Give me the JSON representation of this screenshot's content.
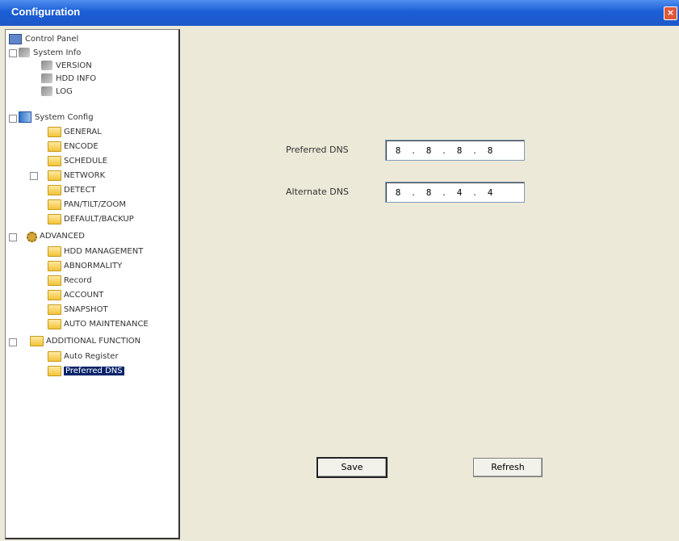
{
  "window": {
    "title": "Configuration",
    "close_label": "×"
  },
  "tree": {
    "items": [
      {
        "label": "Control Panel",
        "icon": "monitor-icon",
        "level": 0
      },
      {
        "label": "System Info",
        "icon": "tool-icon",
        "level": 0
      },
      {
        "label": "VERSION",
        "icon": "tool-icon",
        "level": 1
      },
      {
        "label": "HDD INFO",
        "icon": "tool-icon",
        "level": 1
      },
      {
        "label": "LOG",
        "icon": "tool-icon",
        "level": 1
      },
      {
        "label": "System Config",
        "icon": "sys-icon",
        "level": 0
      },
      {
        "label": "GENERAL",
        "icon": "folder-icon",
        "level": 1
      },
      {
        "label": "ENCODE",
        "icon": "folder-icon",
        "level": 1
      },
      {
        "label": "SCHEDULE",
        "icon": "folder-icon",
        "level": 1
      },
      {
        "label": "NETWORK",
        "icon": "folder-icon",
        "level": 1
      },
      {
        "label": "DETECT",
        "icon": "folder-icon",
        "level": 1
      },
      {
        "label": "PAN/TILT/ZOOM",
        "icon": "folder-icon",
        "level": 1
      },
      {
        "label": "DEFAULT/BACKUP",
        "icon": "folder-icon",
        "level": 1
      },
      {
        "label": "ADVANCED",
        "icon": "gear-icon",
        "level": 0
      },
      {
        "label": "HDD MANAGEMENT",
        "icon": "folder-icon",
        "level": 1
      },
      {
        "label": "ABNORMALITY",
        "icon": "folder-icon",
        "level": 1
      },
      {
        "label": "Record",
        "icon": "folder-icon",
        "level": 1
      },
      {
        "label": "ACCOUNT",
        "icon": "folder-icon",
        "level": 1
      },
      {
        "label": "SNAPSHOT",
        "icon": "folder-icon",
        "level": 1
      },
      {
        "label": "AUTO MAINTENANCE",
        "icon": "folder-icon",
        "level": 1
      },
      {
        "label": "ADDITIONAL FUNCTION",
        "icon": "folder-icon",
        "level": 0
      },
      {
        "label": "Auto Register",
        "icon": "folder-icon",
        "level": 1
      },
      {
        "label": "Preferred DNS",
        "icon": "folder-icon",
        "level": 1,
        "selected": true
      }
    ]
  },
  "form": {
    "preferred_dns_label": "Preferred DNS",
    "preferred_dns": [
      "8",
      "8",
      "8",
      "8"
    ],
    "alternate_dns_label": "Alternate DNS",
    "alternate_dns": [
      "8",
      "8",
      "4",
      "4"
    ],
    "save_label": "Save",
    "refresh_label": "Refresh"
  }
}
